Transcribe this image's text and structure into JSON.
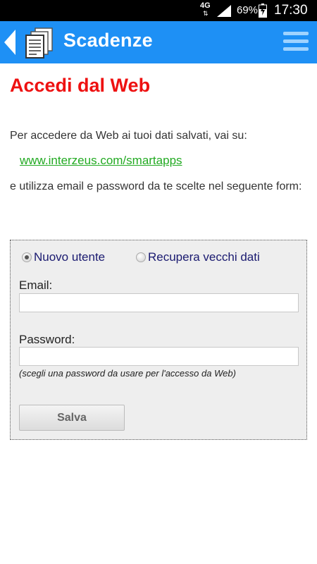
{
  "status_bar": {
    "network_type": "4G",
    "network_arrows": "⇅",
    "battery_percent": "69%",
    "time": "17:30"
  },
  "app_bar": {
    "title": "Scadenze",
    "back_icon": "chevron-left-icon",
    "app_icon": "document-stack-icon",
    "menu_icon": "hamburger-menu-icon",
    "background_color": "#1e90f5"
  },
  "content": {
    "title": "Accedi dal Web",
    "title_color": "#ee1111",
    "intro": "Per accedere da Web ai tuoi dati salvati, vai su:",
    "link": "www.interzeus.com/smartapps",
    "instructions": "e utilizza email e password da te scelte nel seguente form:"
  },
  "form": {
    "radio_options": [
      {
        "label": "Nuovo utente",
        "selected": true
      },
      {
        "label": "Recupera vecchi dati",
        "selected": false
      }
    ],
    "email_label": "Email:",
    "email_value": "",
    "password_label": "Password:",
    "password_value": "",
    "password_hint": "(scegli una password da usare per l'accesso da Web)",
    "save_label": "Salva"
  }
}
